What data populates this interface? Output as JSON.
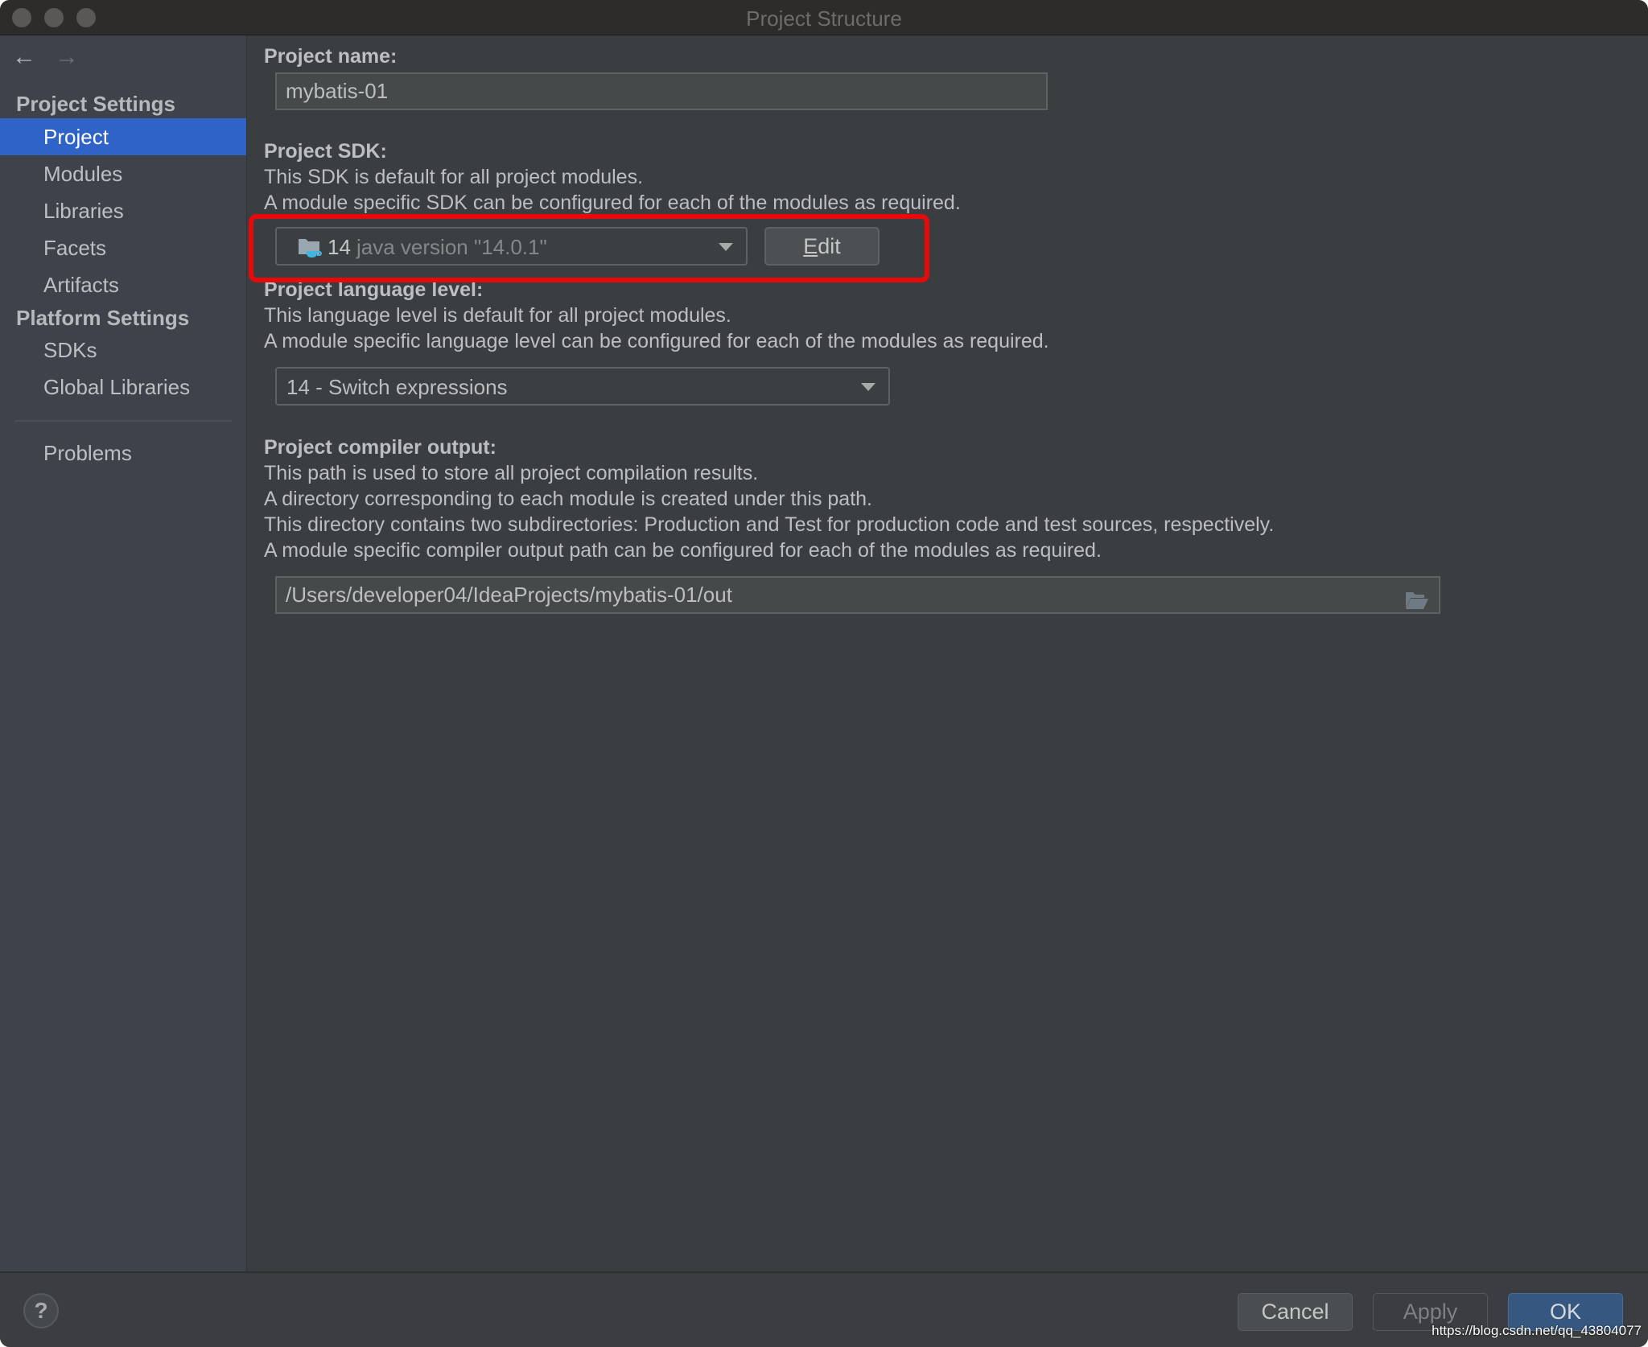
{
  "window": {
    "title": "Project Structure"
  },
  "sidebar": {
    "back_icon": "arrow-left-icon",
    "forward_icon": "arrow-right-icon",
    "sections": [
      {
        "heading": "Project Settings",
        "items": [
          "Project",
          "Modules",
          "Libraries",
          "Facets",
          "Artifacts"
        ]
      },
      {
        "heading": "Platform Settings",
        "items": [
          "SDKs",
          "Global Libraries"
        ]
      }
    ],
    "problems_label": "Problems",
    "selected": "Project"
  },
  "main": {
    "project_name": {
      "label": "Project name:",
      "value": "mybatis-01"
    },
    "project_sdk": {
      "label": "Project SDK:",
      "desc": [
        "This SDK is default for all project modules.",
        "A module specific SDK can be configured for each of the modules as required."
      ],
      "selected_version": "14",
      "selected_detail": "java version \"14.0.1\"",
      "icon": "java-sdk-folder-icon",
      "edit_label": "Edit",
      "edit_mnemonic": "E",
      "highlight_color": "#e80a0a"
    },
    "language_level": {
      "label": "Project language level:",
      "desc": [
        "This language level is default for all project modules.",
        "A module specific language level can be configured for each of the modules as required."
      ],
      "selected": "14 - Switch expressions"
    },
    "compiler_output": {
      "label": "Project compiler output:",
      "desc": [
        "This path is used to store all project compilation results.",
        "A directory corresponding to each module is created under this path.",
        "This directory contains two subdirectories: Production and Test for production code and test sources, respectively.",
        "A module specific compiler output path can be configured for each of the modules as required."
      ],
      "value": "/Users/developer04/IdeaProjects/mybatis-01/out",
      "browse_icon": "folder-open-icon"
    }
  },
  "footer": {
    "help_label": "?",
    "cancel_label": "Cancel",
    "apply_label": "Apply",
    "ok_label": "OK",
    "accent": "#365880"
  },
  "watermark": "https://blog.csdn.net/qq_43804077"
}
